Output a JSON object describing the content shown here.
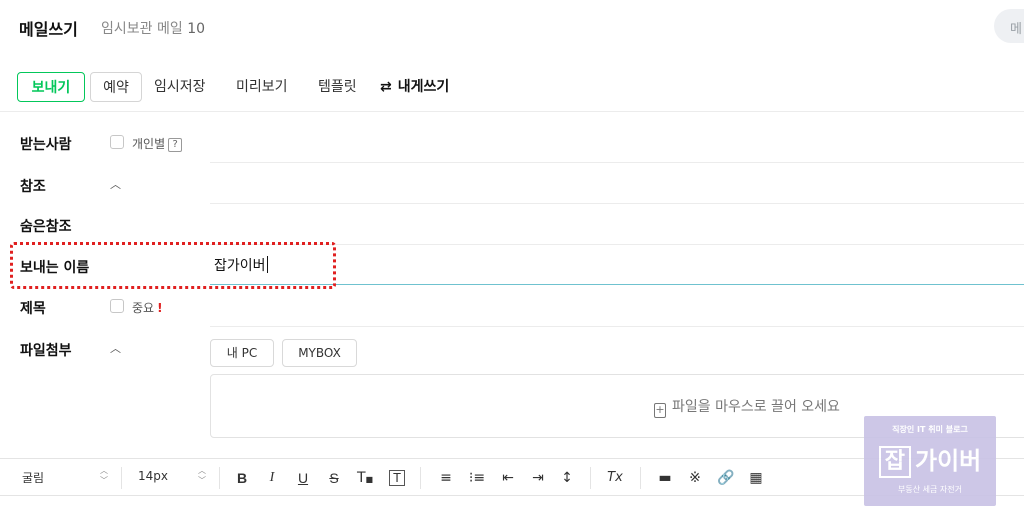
{
  "header": {
    "title": "메일쓰기",
    "draft_label": "임시보관 메일",
    "draft_count": "10",
    "right_button": "메"
  },
  "toolbar": {
    "send": "보내기",
    "reserve": "예약",
    "save_draft": "임시저장",
    "preview": "미리보기",
    "template": "템플릿",
    "to_self": "내게쓰기"
  },
  "fields": {
    "recipient_label": "받는사람",
    "individual_label": "개인별",
    "individual_help": "?",
    "cc_label": "참조",
    "bcc_label": "숨은참조",
    "sender_label": "보내는 이름",
    "sender_value": "잡가이버",
    "subject_label": "제목",
    "important_label": "중요",
    "important_mark": "!",
    "attach_label": "파일첨부",
    "attach_pc": "내 PC",
    "attach_mybox": "MYBOX",
    "drop_hint": "파일을 마우스로 끌어 오세요"
  },
  "editor": {
    "font": "굴림",
    "size": "14px",
    "bold": "B",
    "italic": "I",
    "underline": "U",
    "strike": "S",
    "clear_format": "Tx"
  },
  "watermark": {
    "top": "직장인 IT 취미 블로그",
    "badge": "잡",
    "main": "가이버",
    "bottom": "부동산 세금 자전거"
  },
  "colors": {
    "accent": "#03c75a",
    "highlight": "#e02020",
    "focus": "#6fc2cf"
  }
}
